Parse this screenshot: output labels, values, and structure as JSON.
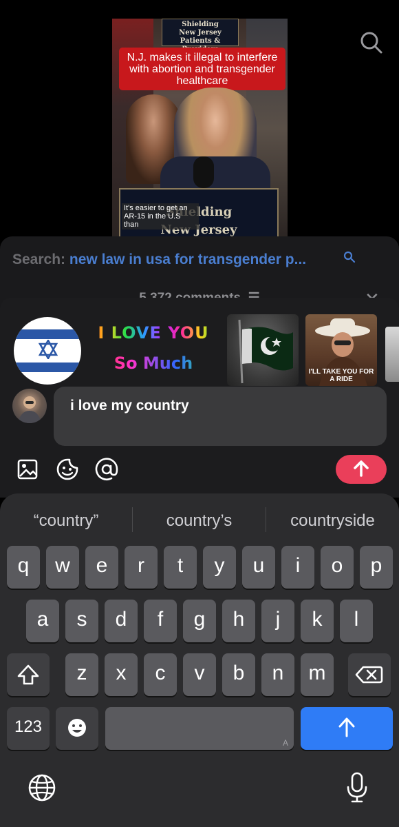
{
  "video": {
    "top_sign": [
      "Shielding",
      "New Jersey",
      "Patients & Providers"
    ],
    "banner": "N.J. makes it illegal to interfere with abortion and transgender healthcare",
    "podium_text": [
      "Shielding",
      "New Jersey"
    ],
    "caption": "It's easier to get an AR-15 in the U.S than"
  },
  "comments_sheet": {
    "search_label": "Search:",
    "search_query": "new law in usa for transgender p...",
    "comments_count": "5,372 comments",
    "close_icon": "close-icon"
  },
  "stickers": {
    "love_line1": "I LOVE YOU",
    "love_line2": "So Much",
    "cowboy_caption": "I'LL TAKE YOU FOR A RIDE"
  },
  "composer": {
    "input_value": "i love my country",
    "tools": [
      "image-icon",
      "emoji-icon",
      "mention-icon"
    ],
    "send_color": "#ea3f5a"
  },
  "keyboard": {
    "suggestions": [
      "“country”",
      "country’s",
      "countryside"
    ],
    "row1": [
      "q",
      "w",
      "e",
      "r",
      "t",
      "y",
      "u",
      "i",
      "o",
      "p"
    ],
    "row2": [
      "a",
      "s",
      "d",
      "f",
      "g",
      "h",
      "j",
      "k",
      "l"
    ],
    "row3": [
      "z",
      "x",
      "c",
      "v",
      "b",
      "n",
      "m"
    ],
    "numbers_label": "123",
    "space_hint": "A",
    "return_color": "#2f7cf6"
  }
}
